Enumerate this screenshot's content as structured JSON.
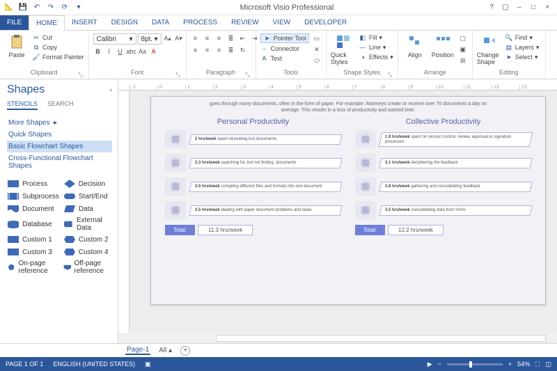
{
  "app_title": "Microsoft Visio Professional",
  "qat": [
    "save",
    "undo",
    "redo",
    "refresh"
  ],
  "tabs": [
    "FILE",
    "HOME",
    "INSERT",
    "DESIGN",
    "DATA",
    "PROCESS",
    "REVIEW",
    "VIEW",
    "DEVELOPER"
  ],
  "active_tab": "HOME",
  "ribbon": {
    "clipboard": {
      "label": "Clipboard",
      "paste": "Paste",
      "cut": "Cut",
      "copy": "Copy",
      "format_painter": "Format Painter"
    },
    "font": {
      "label": "Font",
      "family": "Calibri",
      "size": "8pt."
    },
    "paragraph": {
      "label": "Paragraph"
    },
    "tools": {
      "label": "Tools",
      "pointer": "Pointer Tool",
      "connector": "Connector",
      "text": "Text"
    },
    "shape_styles": {
      "label": "Shape Styles",
      "quick": "Quick Styles",
      "fill": "Fill",
      "line": "Line",
      "effects": "Effects"
    },
    "arrange": {
      "label": "Arrange",
      "align": "Align",
      "position": "Position"
    },
    "editing": {
      "label": "Editing",
      "change": "Change Shape",
      "find": "Find",
      "layers": "Layers",
      "select": "Select"
    }
  },
  "shapes_panel": {
    "title": "Shapes",
    "tabs": [
      "STENCILS",
      "SEARCH"
    ],
    "more": "More Shapes",
    "stencils": [
      "Quick Shapes",
      "Basic Flowchart Shapes",
      "Cross-Functional Flowchart Shapes"
    ],
    "selected_stencil": "Basic Flowchart Shapes",
    "shapes": [
      {
        "name": "Process",
        "kind": "rect"
      },
      {
        "name": "Decision",
        "kind": "diamond"
      },
      {
        "name": "Subprocess",
        "kind": "subproc"
      },
      {
        "name": "Start/End",
        "kind": "pill"
      },
      {
        "name": "Document",
        "kind": "doc"
      },
      {
        "name": "Data",
        "kind": "para"
      },
      {
        "name": "Database",
        "kind": "db"
      },
      {
        "name": "External Data",
        "kind": "cyl"
      },
      {
        "name": "Custom 1",
        "kind": "rect"
      },
      {
        "name": "Custom 2",
        "kind": "hex"
      },
      {
        "name": "Custom 3",
        "kind": "rect"
      },
      {
        "name": "Custom 4",
        "kind": "hex"
      },
      {
        "name": "On-page reference",
        "kind": "circle"
      },
      {
        "name": "Off-page reference",
        "kind": "offpage"
      }
    ]
  },
  "doc": {
    "intro": "goes through many documents, often in the form of paper. For example: Attorneys create or receive over 70 documents a day on average. This results in a loss of productivity and wasted time.",
    "col1_title": "Personal Productivity",
    "col2_title": "Collective Productivity",
    "col1": [
      {
        "bold": "2 hrs/week",
        "text": " spent recreating lost documents"
      },
      {
        "bold": "2.3 hrs/week",
        "text": " searching for, but not finding, documents"
      },
      {
        "bold": "3.5 hrs/week",
        "text": " compiling different files and formats into one document"
      },
      {
        "bold": "3.5 hrs/week",
        "text": " dealing with paper document problems and tasks"
      }
    ],
    "col2": [
      {
        "bold": "1.9 hrs/week",
        "text": " spent on version control, review, approval or signature processes"
      },
      {
        "bold": "3.1 hrs/week",
        "text": " deciphering the feedback"
      },
      {
        "bold": "3.8 hrs/week",
        "text": " gathering and consolidating feedback"
      },
      {
        "bold": "3.5 hrs/week",
        "text": " consolidating data from forms"
      }
    ],
    "total_label": "Total:",
    "total1": "11.3 hrs/week",
    "total2": "12.2 hrs/week"
  },
  "pagebar": {
    "page": "Page-1",
    "all": "All"
  },
  "status": {
    "page": "PAGE 1 OF 1",
    "lang": "ENGLISH (UNITED STATES)",
    "zoom": "54%"
  }
}
